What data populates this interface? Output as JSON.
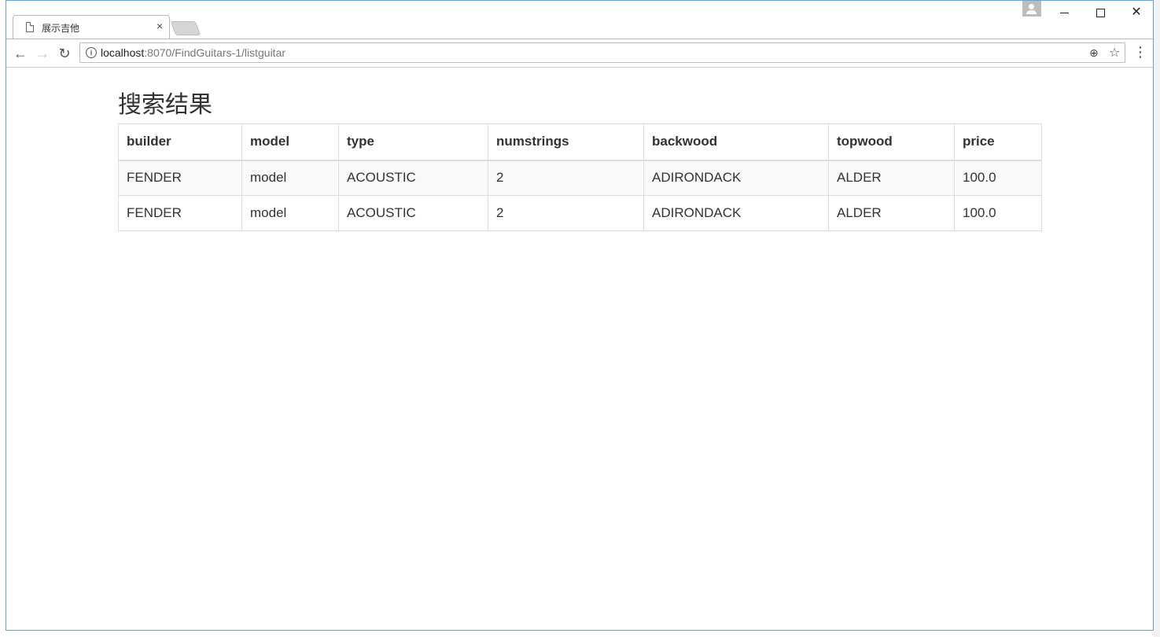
{
  "browser": {
    "tab_title": "展示吉他",
    "tab_close": "×",
    "url_host": "localhost",
    "url_rest": ":8070/FindGuitars-1/listguitar",
    "info_glyph": "i",
    "window_controls": {
      "close": "✕"
    }
  },
  "page": {
    "heading": "搜索结果",
    "columns": [
      "builder",
      "model",
      "type",
      "numstrings",
      "backwood",
      "topwood",
      "price"
    ],
    "rows": [
      [
        "FENDER",
        "model",
        "ACOUSTIC",
        "2",
        "ADIRONDACK",
        "ALDER",
        "100.0"
      ],
      [
        "FENDER",
        "model",
        "ACOUSTIC",
        "2",
        "ADIRONDACK",
        "ALDER",
        "100.0"
      ]
    ]
  },
  "icons": {
    "back": "←",
    "forward": "→",
    "reload": "↻",
    "zoom": "⊕",
    "star": "☆",
    "menu": "⋮"
  }
}
